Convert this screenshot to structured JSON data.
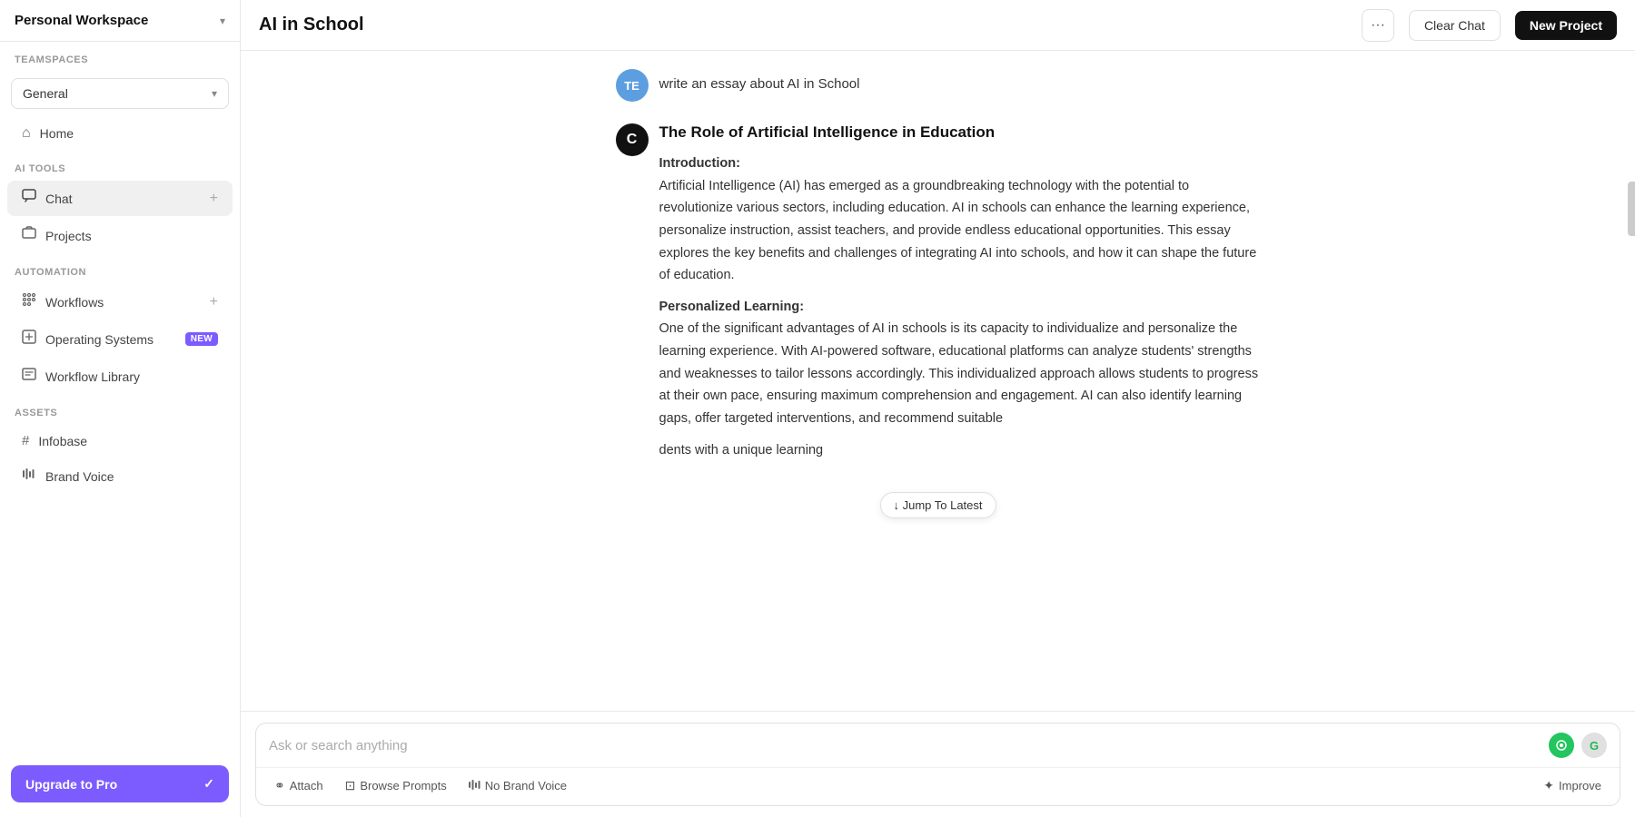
{
  "sidebar": {
    "workspace_label": "Personal Workspace",
    "workspace_chevron": "▾",
    "teamspaces_label": "Teamspaces",
    "general_label": "General",
    "general_chevron": "▾",
    "nav_label": "",
    "home_label": "Home",
    "ai_tools_label": "AI Tools",
    "chat_label": "Chat",
    "projects_label": "Projects",
    "automation_label": "Automation",
    "workflows_label": "Workflows",
    "operating_systems_label": "Operating Systems",
    "new_badge": "NEW",
    "workflow_library_label": "Workflow Library",
    "assets_label": "Assets",
    "infobase_label": "Infobase",
    "brand_voice_label": "Brand Voice",
    "upgrade_label": "Upgrade to Pro"
  },
  "topbar": {
    "title": "AI in School",
    "more_icon": "···",
    "clear_chat_label": "Clear Chat",
    "new_project_label": "New Project"
  },
  "chat": {
    "user_avatar": "TE",
    "user_message": "write an essay about AI in School",
    "ai_avatar": "C",
    "ai_title": "The Role of Artificial Intelligence in Education",
    "intro_header": "Introduction:",
    "intro_body": "Artificial Intelligence (AI) has emerged as a groundbreaking technology with the potential to revolutionize various sectors, including education. AI in schools can enhance the learning experience, personalize instruction, assist teachers, and provide endless educational opportunities. This essay explores the key benefits and challenges of integrating AI into schools, and how it can shape the future of education.",
    "personalized_header": "Personalized Learning:",
    "personalized_body": "One of the significant advantages of AI in schools is its capacity to individualize and personalize the learning experience. With AI-powered software, educational platforms can analyze students' strengths and weaknesses to tailor lessons accordingly. This individualized approach allows students to progress at their own pace, ensuring maximum comprehension and engagement. AI can also identify learning gaps, offer targeted interventions, and recommend suitable",
    "personalized_body2": "dents with a unique learning",
    "jump_label": "↓  Jump To Latest"
  },
  "input": {
    "placeholder": "Ask or search anything",
    "attach_label": "Attach",
    "browse_prompts_label": "Browse Prompts",
    "brand_voice_label": "No Brand Voice",
    "improve_label": "Improve",
    "icon_green": "◉",
    "icon_gray": "G"
  }
}
